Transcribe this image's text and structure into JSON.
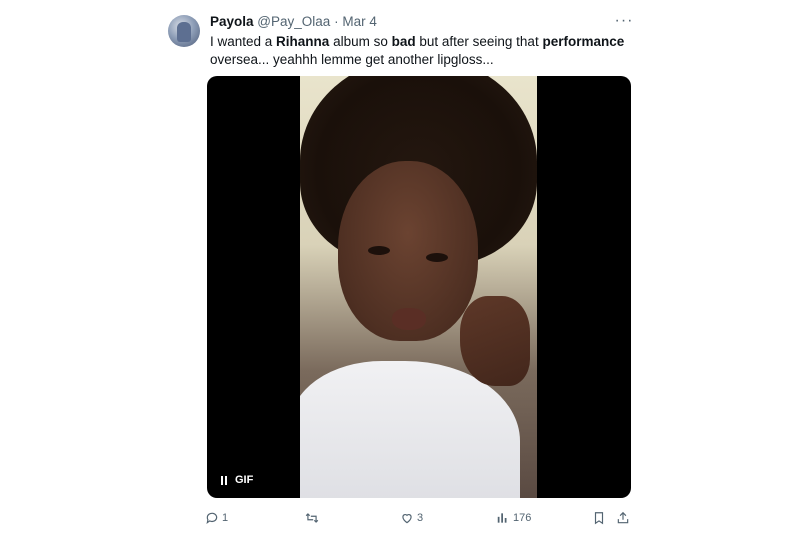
{
  "tweet": {
    "author_name": "Payola",
    "handle": "@Pay_Olaa",
    "separator": "·",
    "date": "Mar 4",
    "text_parts": [
      "I wanted a ",
      "Rihanna",
      " album so ",
      "bad",
      " but after seeing that ",
      "performance",
      " oversea... yeahhh lemme get another lipgloss..."
    ]
  },
  "media": {
    "badge": "GIF"
  },
  "actions": {
    "replies": "1",
    "retweets": "",
    "likes": "3",
    "views": "176"
  },
  "icons": {
    "more": "more-icon",
    "reply": "reply-icon",
    "retweet": "retweet-icon",
    "like": "heart-icon",
    "views": "views-icon",
    "bookmark": "bookmark-icon",
    "share": "share-icon",
    "pause": "pause-icon"
  },
  "colors": {
    "text": "#0f1419",
    "secondary": "#536471",
    "media_bg": "#000000"
  }
}
